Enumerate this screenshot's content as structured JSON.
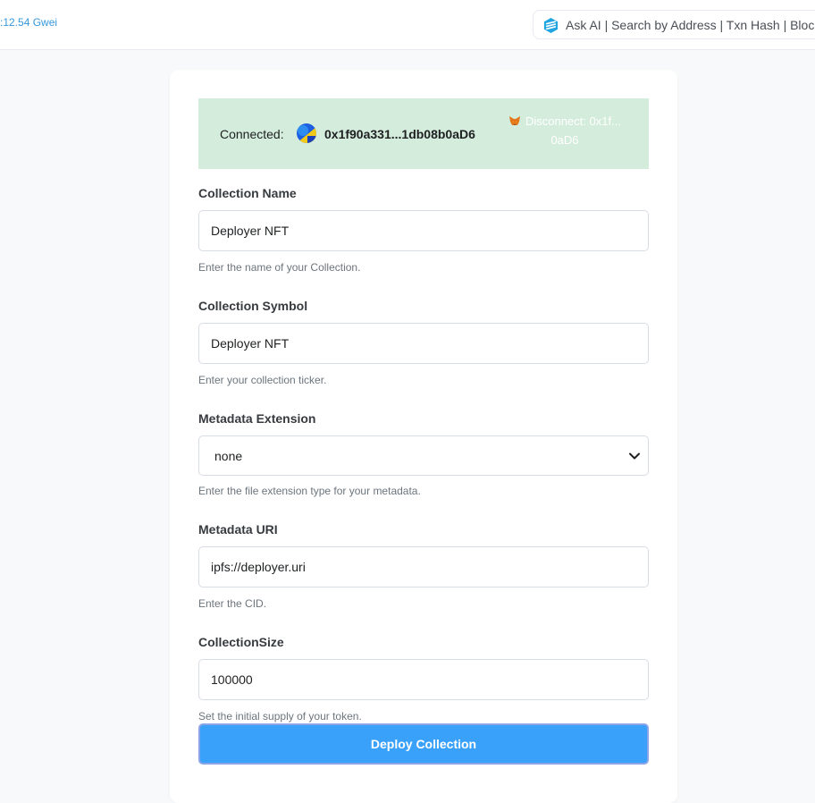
{
  "header": {
    "gas_text": ":12.54 Gwei",
    "search_text": "Ask AI | Search by Address | Txn Hash | Block"
  },
  "wallet": {
    "connected_label": "Connected:",
    "address": "0x1f90a331...1db08b0aD6",
    "disconnect_line1": "Disconnect: 0x1f...",
    "disconnect_line2": "0aD6"
  },
  "form": {
    "collection_name": {
      "label": "Collection Name",
      "value": "Deployer NFT",
      "hint": "Enter the name of your Collection."
    },
    "collection_symbol": {
      "label": "Collection Symbol",
      "value": "Deployer NFT",
      "hint": "Enter your collection ticker."
    },
    "metadata_extension": {
      "label": "Metadata Extension",
      "selected": "none",
      "hint": "Enter the file extension type for your metadata."
    },
    "metadata_uri": {
      "label": "Metadata URI",
      "value": "ipfs://deployer.uri",
      "hint": "Enter the CID."
    },
    "collection_size": {
      "label": "CollectionSize",
      "value": "100000",
      "hint": "Set the initial supply of your token."
    },
    "deploy_label": "Deploy Collection"
  },
  "icons": {
    "search_logo": "etherscan-logo-icon",
    "wallet_avatar": "avatar-icon",
    "metamask": "metamask-fox-icon",
    "select_arrow": "chevron-down-icon"
  },
  "colors": {
    "accent": "#3aa1fb",
    "connected_bg": "#d4ecdc",
    "gas_text": "#3498db"
  }
}
